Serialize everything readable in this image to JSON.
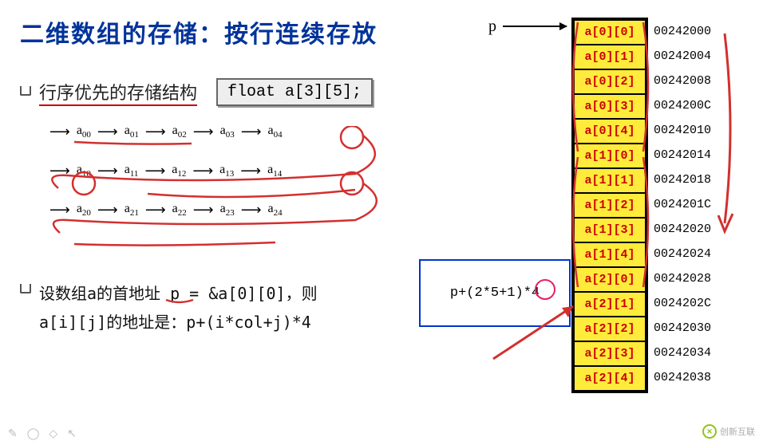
{
  "title": "二维数组的存储：按行连续存放",
  "subtitle": "行序优先的存储结构",
  "code_decl": "float a[3][5];",
  "flow": {
    "rows": [
      [
        "a00",
        "a01",
        "a02",
        "a03",
        "a04"
      ],
      [
        "a10",
        "a11",
        "a12",
        "a13",
        "a14"
      ],
      [
        "a20",
        "a21",
        "a22",
        "a23",
        "a24"
      ]
    ]
  },
  "formula_line1": "设数组a的首地址 p = &a[0][0]，则",
  "formula_line2": "a[i][j]的地址是：p+(i*col+j)*4",
  "pointer_label": "p",
  "formula_box": "p+(2*5+1)*4",
  "memory": [
    {
      "cell": "a[0][0]",
      "addr": "00242000"
    },
    {
      "cell": "a[0][1]",
      "addr": "00242004"
    },
    {
      "cell": "a[0][2]",
      "addr": "00242008"
    },
    {
      "cell": "a[0][3]",
      "addr": "0024200C"
    },
    {
      "cell": "a[0][4]",
      "addr": "00242010"
    },
    {
      "cell": "a[1][0]",
      "addr": "00242014"
    },
    {
      "cell": "a[1][1]",
      "addr": "00242018"
    },
    {
      "cell": "a[1][2]",
      "addr": "0024201C"
    },
    {
      "cell": "a[1][3]",
      "addr": "00242020"
    },
    {
      "cell": "a[1][4]",
      "addr": "00242024"
    },
    {
      "cell": "a[2][0]",
      "addr": "00242028"
    },
    {
      "cell": "a[2][1]",
      "addr": "0024202C"
    },
    {
      "cell": "a[2][2]",
      "addr": "00242030"
    },
    {
      "cell": "a[2][3]",
      "addr": "00242034"
    },
    {
      "cell": "a[2][4]",
      "addr": "00242038"
    }
  ],
  "watermark": "创新互联",
  "colors": {
    "title": "#003399",
    "cell_bg": "#ffeb3b",
    "cell_text": "#cc0000",
    "annotation_red": "#d32f2f",
    "annotation_magenta": "#e91e63"
  }
}
